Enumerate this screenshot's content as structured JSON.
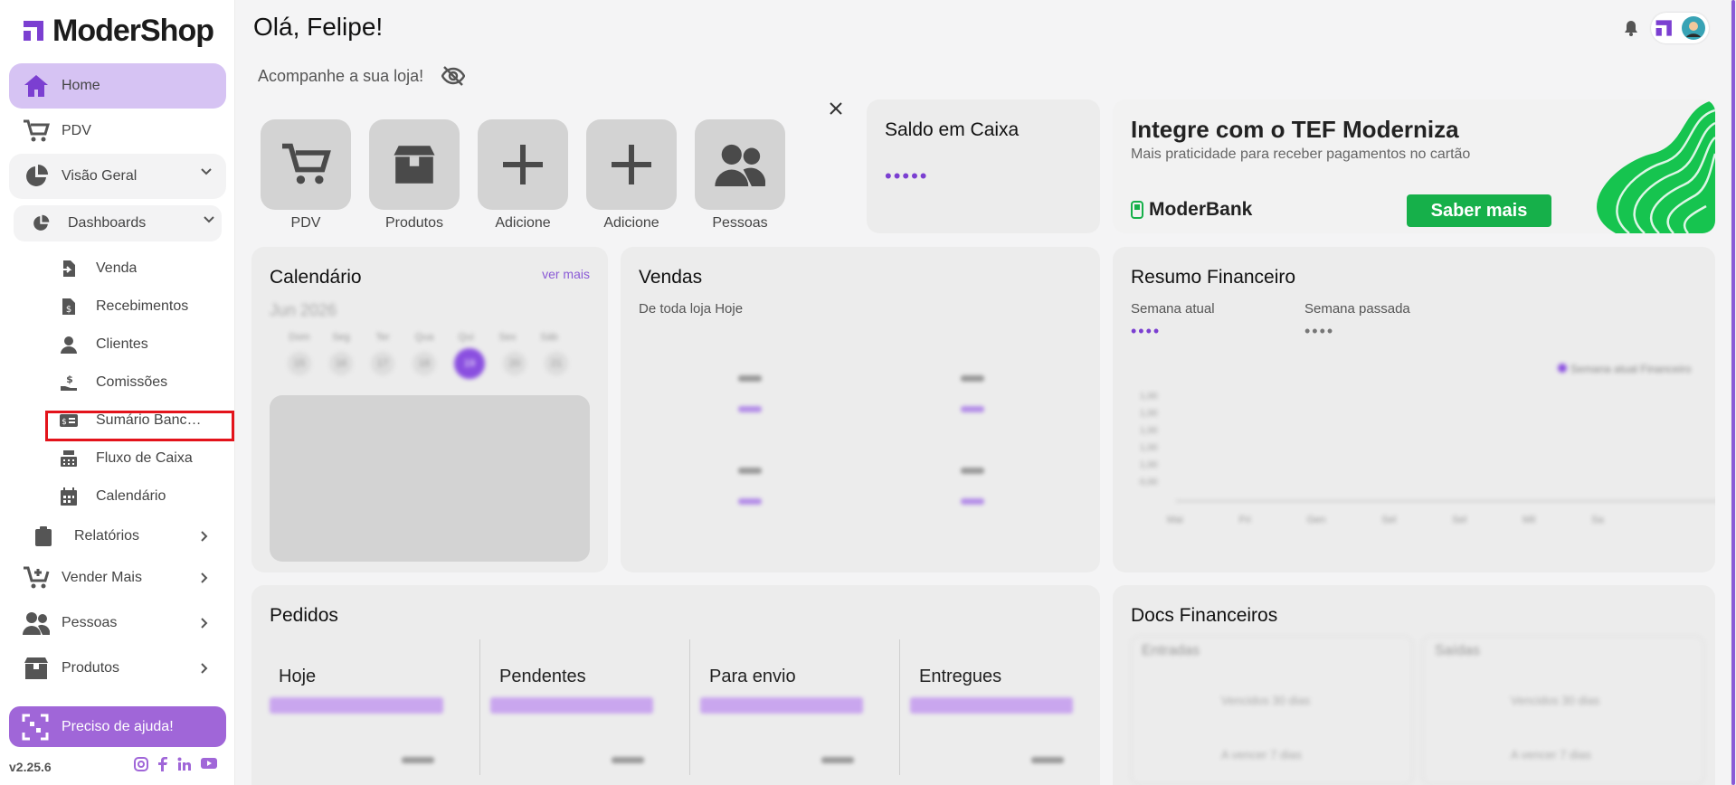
{
  "brand": {
    "name": "ModerShop",
    "version": "v2.25.6",
    "accent": "#a066d8"
  },
  "nav": {
    "home": "Home",
    "pdv": "PDV",
    "visao_geral": "Visão Geral",
    "dashboards": "Dashboards",
    "dash_items": [
      {
        "label": "Venda",
        "icon": "doc-arrow-icon"
      },
      {
        "label": "Recebimentos",
        "icon": "receipt-dollar-icon"
      },
      {
        "label": "Clientes",
        "icon": "person-icon"
      },
      {
        "label": "Comissões",
        "icon": "hand-coin-icon"
      },
      {
        "label": "Sumário Bancário",
        "icon": "money-card-icon"
      },
      {
        "label": "Fluxo de Caixa",
        "icon": "cash-register-icon"
      },
      {
        "label": "Calendário",
        "icon": "calendar-icon"
      }
    ],
    "relatorios": "Relatórios",
    "vender_mais": "Vender Mais",
    "pessoas": "Pessoas",
    "produtos": "Produtos",
    "help": "Preciso de ajuda!"
  },
  "header": {
    "greeting": "Olá, Felipe!",
    "subtitle": "Acompanhe a sua loja!"
  },
  "quick_actions": [
    "PDV",
    "Produtos",
    "Adicione",
    "Adicione",
    "Pessoas"
  ],
  "saldo": {
    "title": "Saldo em Caixa",
    "value": "•••••"
  },
  "banner": {
    "title": "Integre com o TEF Moderniza",
    "subtitle": "Mais praticidade para receber pagamentos no cartão",
    "brand": "ModerBank",
    "button": "Saber mais"
  },
  "calendario": {
    "title": "Calendário",
    "link": "ver mais",
    "month": "Jun 2026",
    "weekdays": [
      "Dom",
      "Seg",
      "Ter",
      "Qua",
      "Qui",
      "Sex",
      "Sáb"
    ],
    "days": [
      "15",
      "16",
      "17",
      "18",
      "19",
      "20",
      "21"
    ]
  },
  "vendas": {
    "title": "Vendas",
    "subtitle": "De toda loja Hoje"
  },
  "resumo": {
    "title": "Resumo Financeiro",
    "current_label": "Semana atual",
    "current_value": "••••",
    "past_label": "Semana passada",
    "past_value": "••••",
    "legend": "Semana atual  Financeiro",
    "yticks": [
      "1,00",
      "1,00",
      "1,00",
      "1,00",
      "1,00",
      "0,00"
    ],
    "xticks": [
      "Mai",
      "Fri",
      "Gen",
      "Sel",
      "Sel",
      "Mil",
      "Sa"
    ]
  },
  "pedidos": {
    "title": "Pedidos",
    "cols": [
      "Hoje",
      "Pendentes",
      "Para envio",
      "Entregues"
    ]
  },
  "docs": {
    "title": "Docs Financeiros",
    "left": "Entradas",
    "right": "Saídas",
    "l1": "Vencidos 30 dias",
    "l2": "A vencer 7 dias",
    "r1": "Vencidos 30 dias",
    "r2": "A vencer 7 dias"
  }
}
